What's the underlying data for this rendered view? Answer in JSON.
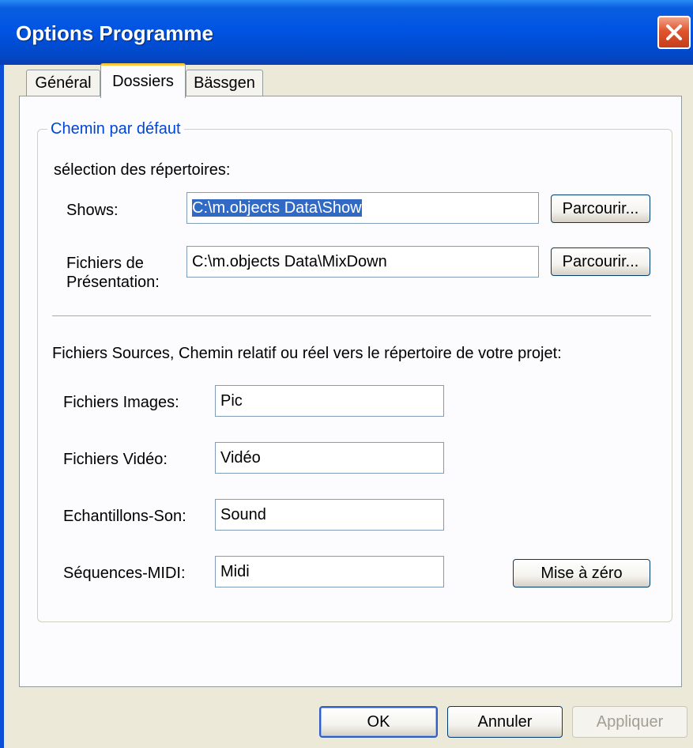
{
  "window": {
    "title": "Options Programme"
  },
  "tabs": [
    {
      "label": "Général",
      "active": false
    },
    {
      "label": "Dossiers",
      "active": true
    },
    {
      "label": "Bässgen",
      "active": false
    }
  ],
  "group": {
    "legend": "Chemin par défaut",
    "selection_label": "sélection des répertoires:",
    "shows": {
      "label": "Shows:",
      "value": "C:\\m.objects Data\\Show",
      "button": "Parcourir..."
    },
    "presentation": {
      "label_line1": "Fichiers de",
      "label_line2": "Présentation:",
      "value": "C:\\m.objects Data\\MixDown",
      "button": "Parcourir..."
    },
    "sources_label": "Fichiers Sources, Chemin relatif ou réel vers le répertoire de votre projet:",
    "images": {
      "label": "Fichiers Images:",
      "value": "Pic"
    },
    "video": {
      "label": "Fichiers Vidéo:",
      "value": "Vidéo"
    },
    "sound": {
      "label": "Echantillons-Son:",
      "value": "Sound"
    },
    "midi": {
      "label": "Séquences-MIDI:",
      "value": "Midi"
    },
    "reset_button": "Mise à zéro"
  },
  "footer": {
    "ok": "OK",
    "cancel": "Annuler",
    "apply": "Appliquer"
  },
  "colors": {
    "titlebar": "#0054e3",
    "close": "#e0552e",
    "legend": "#0046d5",
    "selection": "#316ac5",
    "tab_highlight": "#ffc83c"
  },
  "icons": {
    "close": "close-icon"
  }
}
